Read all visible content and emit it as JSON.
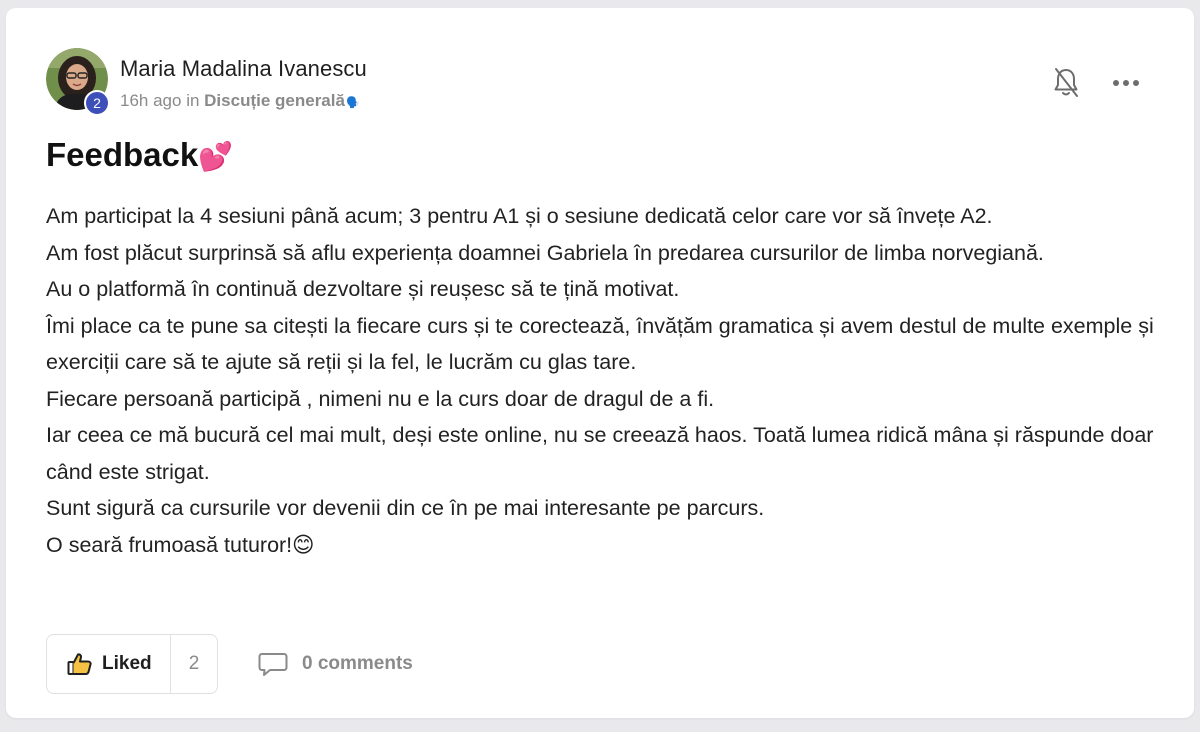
{
  "post": {
    "author": "Maria Madalina Ivanescu",
    "author_level": "2",
    "time_ago": "16h ago",
    "in_word": "in",
    "category": "Discuție generală",
    "category_emoji": "🗣️",
    "title": "Feedback",
    "title_emoji": "💕",
    "body": [
      "Am participat la 4 sesiuni până acum; 3 pentru A1 și o sesiune dedicată celor care vor să învețe A2.",
      "Am fost plăcut surprinsă să aflu experiența doamnei Gabriela în predarea cursurilor de limba norvegiană.",
      "Au o platformă în continuă dezvoltare și reușesc să te țină motivat.",
      "Îmi place ca te pune sa citești la fiecare curs și te corectează, învățăm gramatica și avem destul de multe exemple și exerciții care să te ajute să reții și la fel, le lucrăm cu glas tare.",
      "Fiecare persoană participă , nimeni nu e la curs doar de dragul de a fi.",
      "Iar ceea ce mă bucură cel mai mult, deși este online, nu se creează haos. Toată lumea ridică mâna și răspunde doar când este strigat.",
      "Sunt sigură ca cursurile vor devenii din ce în pe mai interesante pe parcurs.",
      "O seară frumoasă tuturor!😊"
    ]
  },
  "actions": {
    "like_label": "Liked",
    "like_count": "2",
    "comments_label": "0 comments"
  },
  "icons": {
    "bell": "bell-off-icon",
    "more": "more-horizontal-icon",
    "like": "thumbs-up-icon",
    "comment": "comment-icon"
  },
  "colors": {
    "level_badge": "#3d4fb8",
    "muted_text": "#8a8a8a",
    "body_text": "#222222"
  }
}
